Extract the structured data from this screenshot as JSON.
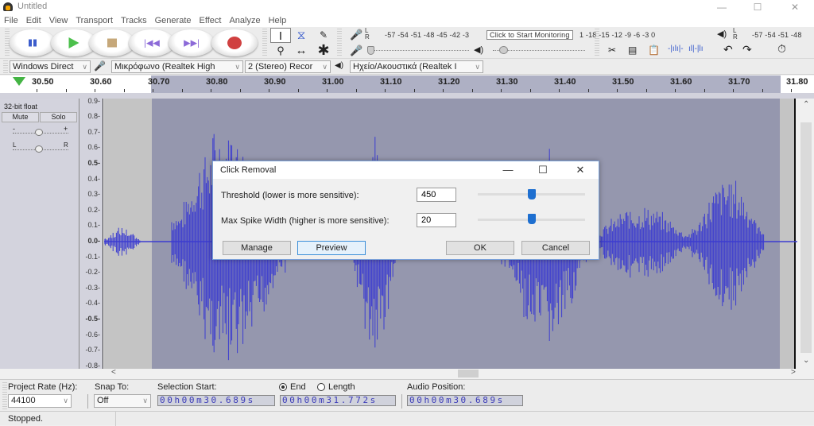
{
  "window": {
    "title": "Untitled",
    "minimize": "—",
    "maximize": "☐",
    "close": "✕"
  },
  "menu": [
    "File",
    "Edit",
    "View",
    "Transport",
    "Tracks",
    "Generate",
    "Effect",
    "Analyze",
    "Help"
  ],
  "transport": {
    "buttons": [
      "pause",
      "play",
      "stop",
      "skip-start",
      "skip-end",
      "record"
    ]
  },
  "tools": [
    "selection-tool",
    "envelope-tool",
    "draw-tool",
    "zoom-tool",
    "timeshift-tool",
    "multi-tool"
  ],
  "meters": {
    "record_scale": "-57 -54 -51 -48 -45 -42 -3",
    "record_scale_end": "1 -18 -15 -12 -9 -6 -3 0",
    "monitor_tooltip": "Click to Start Monitoring",
    "playback_scale": "-57 -54 -51 -48",
    "lr": "L R"
  },
  "devices": {
    "host": "Windows Direct",
    "recording_device": "Μικρόφωνο (Realtek High",
    "channels": "2 (Stereo) Recor",
    "playback_device": "Ηχείο/Ακουστικά (Realtek I"
  },
  "ruler": {
    "ticks": [
      "30.50",
      "30.60",
      "30.70",
      "30.80",
      "30.90",
      "31.00",
      "31.10",
      "31.20",
      "31.30",
      "31.40",
      "31.50",
      "31.60",
      "31.70",
      "31.80"
    ]
  },
  "track": {
    "format": "32-bit float",
    "mute": "Mute",
    "solo": "Solo",
    "gain_minus": "-",
    "gain_plus": "+",
    "pan_left": "L",
    "pan_right": "R",
    "amplitude_labels": [
      "0.9",
      "0.8",
      "0.7",
      "0.6",
      "0.5",
      "0.4",
      "0.3",
      "0.2",
      "0.1",
      "0.0",
      "-0.1",
      "-0.2",
      "-0.3",
      "-0.4",
      "-0.5",
      "-0.6",
      "-0.7",
      "-0.8"
    ]
  },
  "dialog": {
    "title": "Click Removal",
    "threshold_label": "Threshold (lower is more sensitive):",
    "threshold_value": "450",
    "threshold_slider_fraction": 0.5,
    "spike_label": "Max Spike Width (higher is more sensitive):",
    "spike_value": "20",
    "spike_slider_fraction": 0.5,
    "manage": "Manage",
    "preview": "Preview",
    "ok": "OK",
    "cancel": "Cancel"
  },
  "selection_bar": {
    "project_rate_label": "Project Rate (Hz):",
    "project_rate": "44100",
    "snap_label": "Snap To:",
    "snap_value": "Off",
    "selection_start_label": "Selection Start:",
    "end_label": "End",
    "length_label": "Length",
    "start_time": "00h00m30.689s",
    "end_time": "00h00m31.772s",
    "audio_position_label": "Audio Position:",
    "audio_position": "00h00m30.689s"
  },
  "status": "Stopped.",
  "colors": {
    "waveform": "#3c3cd0",
    "selection": "#9597ae",
    "accent": "#1e6fd0"
  }
}
